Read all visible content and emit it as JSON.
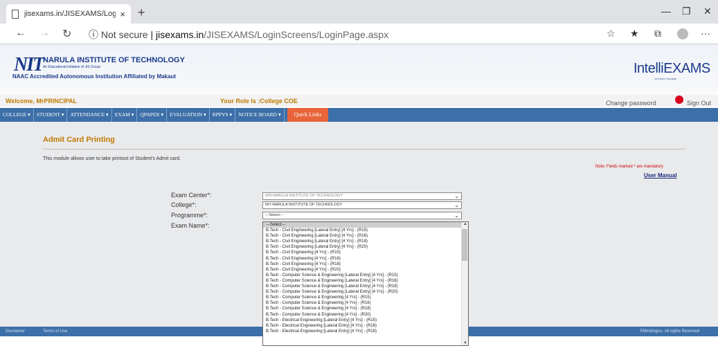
{
  "browser": {
    "tab_title": "jisexams.in/JISEXAMS/LoginScre",
    "tab_close": "×",
    "new_tab": "+",
    "minimize": "—",
    "restore": "❐",
    "close": "✕",
    "back": "←",
    "forward": "→",
    "reload": "↻",
    "security": "ⓘ",
    "not_secure": "Not secure",
    "separator": "|",
    "url_host": "jisexams.in",
    "url_path": "/JISEXAMS/LoginScreens/LoginPage.aspx",
    "favorite": "☆",
    "favorites": "★",
    "collections": "⧉",
    "more": "···"
  },
  "header": {
    "logo": "NIT",
    "institute": "NARULA INSTITUTE OF TECHNOLOGY",
    "institute_sub": "An Educational Initiative of JIS Group",
    "naac": "NAAC Accredited Autonomous Institution Affiliated by Makaut",
    "brand": "IntelliEXAMS",
    "brand_sub": "ACCURACY ASSURED"
  },
  "welcome": {
    "text": "Welcome, MrPRINCIPAL",
    "role": "Your Role Is :College COE",
    "change_password": "Change password",
    "sign_out": "Sign Out"
  },
  "menu": {
    "items": [
      {
        "label": "COLLEGE ▾"
      },
      {
        "label": "STUDENT ▾"
      },
      {
        "label": "ATTENDANCE ▾"
      },
      {
        "label": "EXAM ▾"
      },
      {
        "label": "QPAPER ▾"
      },
      {
        "label": "EVALUATION ▾"
      },
      {
        "label": "RPPVS ▾"
      },
      {
        "label": "NOTICE BOARD ▾"
      }
    ],
    "quick_links": "Quick Links"
  },
  "main": {
    "title": "Admit Card Printing",
    "description": "This module allows user to take printout of Student's Admit card.",
    "note": "Note: Fields marked * are mandatory",
    "user_manual": "User Manual"
  },
  "form": {
    "exam_center_label": "Exam Center*:",
    "exam_center_value": "004-NARULA INSTITUTE OF TECHNOLOGY",
    "college_label": "College*:",
    "college_value": "NIT-NARULA INSTITUTE OF TECHNOLOGY",
    "programme_label": "Programme*:",
    "programme_value": "---Select---",
    "exam_name_label": "Exam Name*:",
    "chevron": "⌄"
  },
  "dropdown": {
    "scroll_up": "▲",
    "scroll_down": "▼",
    "options": [
      "---Select---",
      "B.Tech - Civil Engineering [Lateral Entry] [4 Yrs] - (R15)",
      "B.Tech - Civil Engineering [Lateral Entry] [4 Yrs] - (R16)",
      "B.Tech - Civil Engineering [Lateral Entry] [4 Yrs] - (R18)",
      "B.Tech - Civil Engineering [Lateral Entry] [4 Yrs] - (R20)",
      "B.Tech - Civil Engineering [4 Yrs] - (R15)",
      "B.Tech - Civil Engineering [4 Yrs] - (R16)",
      "B.Tech - Civil Engineering [4 Yrs] - (R18)",
      "B.Tech - Civil Engineering [4 Yrs] - (R20)",
      "B.Tech - Computer Science & Engineering [Lateral Entry] [4 Yrs] - (R15)",
      "B.Tech - Computer Science & Engineering [Lateral Entry] [4 Yrs] - (R16)",
      "B.Tech - Computer Science & Engineering [Lateral Entry] [4 Yrs] - (R18)",
      "B.Tech - Computer Science & Engineering [Lateral Entry] [4 Yrs] - (R20)",
      "B.Tech - Computer Science & Engineering [4 Yrs] - (R15)",
      "B.Tech - Computer Science & Engineering [4 Yrs] - (R16)",
      "B.Tech - Computer Science & Engineering [4 Yrs] - (R18)",
      "B.Tech - Computer Science & Engineering [4 Yrs] - (R20)",
      "B.Tech - Electrical Engineering [Lateral Entry] [4 Yrs] - (R15)",
      "B.Tech - Electrical Engineering [Lateral Entry] [4 Yrs] - (R16)",
      "B.Tech - Electrical Engineering [Lateral Entry] [4 Yrs] - (R18)"
    ]
  },
  "footer": {
    "disclaimer": "Disclaimer",
    "terms": "Terms of Use",
    "copyright": "©Mindlogicx. All rights Reserved"
  }
}
